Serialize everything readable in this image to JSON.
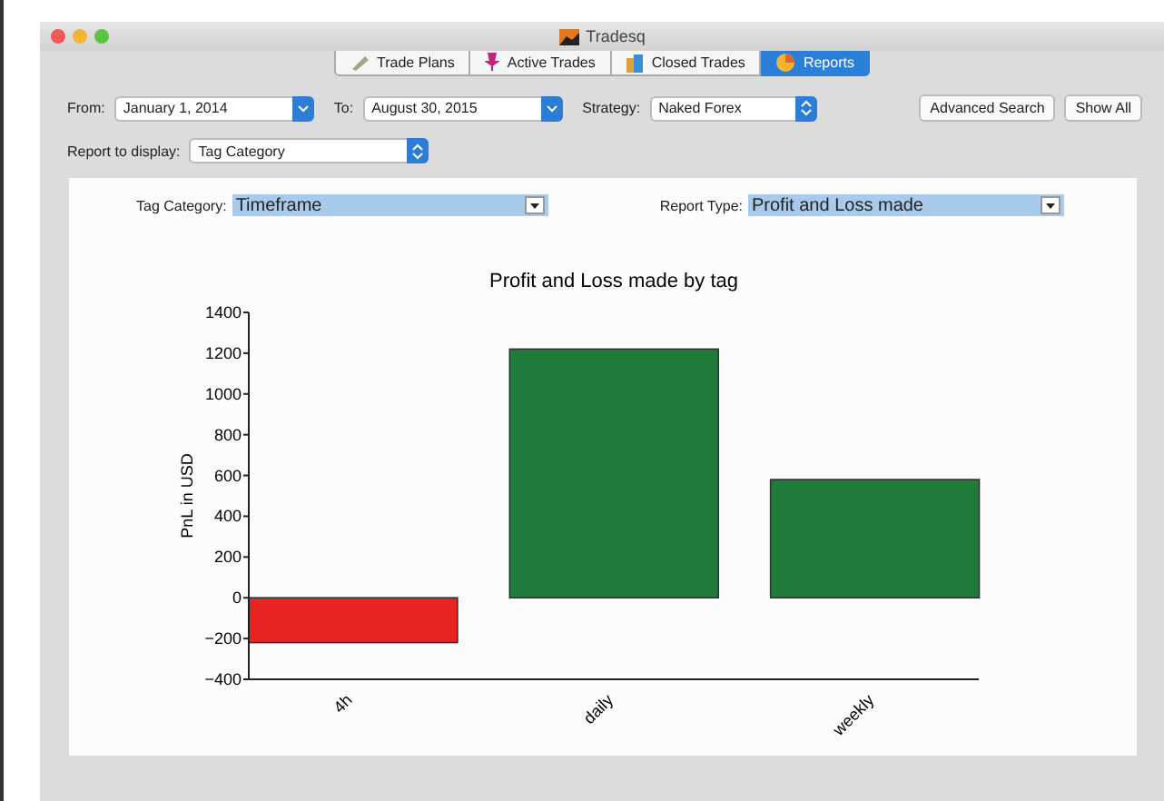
{
  "window": {
    "title": "Tradesq"
  },
  "tabs": [
    {
      "label": "Trade Plans",
      "selected": false
    },
    {
      "label": "Active Trades",
      "selected": false
    },
    {
      "label": "Closed Trades",
      "selected": false
    },
    {
      "label": "Reports",
      "selected": true
    }
  ],
  "filters": {
    "from_label": "From:",
    "from": "January 1, 2014",
    "to_label": "To:",
    "to": "August 30, 2015",
    "strategy_label": "Strategy:",
    "strategy": "Naked Forex",
    "buttons": [
      "Advanced Search",
      "Show All"
    ],
    "report_label": "Report to display:",
    "report": "Tag Category"
  },
  "report": {
    "tag_category_label": "Tag Category:",
    "tag_category": "Timeframe",
    "report_type_label": "Report Type:",
    "report_type": "Profit and Loss made",
    "chart_data": {
      "type": "bar",
      "title": "Profit and Loss made by tag",
      "ylabel": "PnL in USD",
      "categories": [
        "4h",
        "daily",
        "weekly"
      ],
      "values": [
        -220,
        1220,
        580
      ],
      "colors": [
        "#e82323",
        "#1e7b3c",
        "#1e7b3c"
      ],
      "ylim": [
        -400,
        1400
      ],
      "yticks": [
        {
          "value": 1400,
          "label": "1400"
        },
        {
          "value": 1200,
          "label": "1200"
        },
        {
          "value": 1000,
          "label": "1000"
        },
        {
          "value": 800,
          "label": "800"
        },
        {
          "value": 600,
          "label": "600"
        },
        {
          "value": 400,
          "label": "400"
        },
        {
          "value": 200,
          "label": "200"
        },
        {
          "value": 0,
          "label": "0"
        },
        {
          "value": -200,
          "label": "−200"
        },
        {
          "value": -400,
          "label": "−400"
        }
      ]
    }
  }
}
